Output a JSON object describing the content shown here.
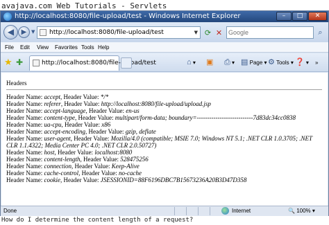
{
  "site_title": "avajava.com Web Tutorials - Servlets",
  "window": {
    "title": "http://localhost:8080/file-upload/test - Windows Internet Explorer",
    "controls": {
      "minimize": "–",
      "maximize": "□",
      "close": "✕"
    }
  },
  "address_bar": {
    "url": "http://localhost:8080/file-upload/test",
    "search_placeholder": "Google",
    "back_glyph": "◀",
    "forward_glyph": "▶"
  },
  "menu": [
    "File",
    "Edit",
    "View",
    "Favorites",
    "Tools",
    "Help"
  ],
  "tab": {
    "title": "http://localhost:8080/file-upload/test"
  },
  "commands": {
    "page": "Page",
    "tools": "Tools"
  },
  "content": {
    "heading": "Headers",
    "headers": [
      {
        "name": "accept",
        "value": "*/*"
      },
      {
        "name": "referer",
        "value": "http://localhost:8080/file-upload/upload.jsp"
      },
      {
        "name": "accept-language",
        "value": "en-us"
      },
      {
        "name": "content-type",
        "value": "multipart/form-data; boundary=---------------------------7d83dc34cc0838"
      },
      {
        "name": "ua-cpu",
        "value": "x86"
      },
      {
        "name": "accept-encoding",
        "value": "gzip, deflate"
      },
      {
        "name": "user-agent",
        "value": "Mozilla/4.0 (compatible; MSIE 7.0; Windows NT 5.1; .NET CLR 1.0.3705; .NET CLR 1.1.4322; Media Center PC 4.0; .NET CLR 2.0.50727)"
      },
      {
        "name": "host",
        "value": "localhost:8080"
      },
      {
        "name": "content-length",
        "value": "528475256"
      },
      {
        "name": "connection",
        "value": "Keep-Alive"
      },
      {
        "name": "cache-control",
        "value": "no-cache"
      },
      {
        "name": "cookie",
        "value": "JSESSIONID=88F6196DBC7B15673236A20B3D47D358"
      }
    ],
    "label_name": "Header Name: ",
    "label_value": ", Header Value: "
  },
  "status_bar": {
    "status": "Done",
    "zone": "Internet",
    "zoom": "100%"
  },
  "question": "How do I determine the content length of a request?"
}
